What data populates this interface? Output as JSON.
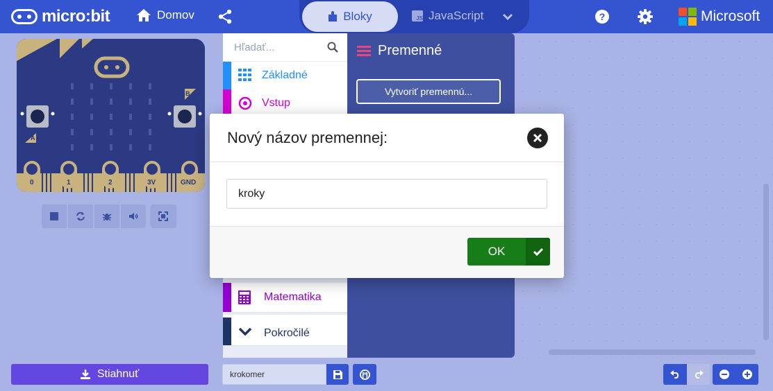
{
  "header": {
    "logo_text": "micro:bit",
    "home_label": "Domov",
    "tabs": {
      "blocks_label": "Bloky",
      "js_label": "JavaScript",
      "js_badge": "JS"
    },
    "brand": "Microsoft",
    "colors": {
      "bar": "#3454d1",
      "ms": [
        "#f25022",
        "#7fba00",
        "#00a4ef",
        "#ffb900"
      ]
    }
  },
  "simulator": {
    "buttons": [
      "stop-icon",
      "restart-icon",
      "debug-icon",
      "sound-icon",
      "fullscreen-icon"
    ],
    "board_labels": {
      "button_a": "A",
      "button_b": "B",
      "pins": [
        "0",
        "1",
        "2",
        "3V",
        "GND"
      ]
    }
  },
  "toolbox": {
    "search_placeholder": "Hľadať...",
    "categories": [
      {
        "label": "Základné",
        "color": "#1e90ff"
      },
      {
        "label": "Vstup",
        "color": "#d400d4"
      },
      {
        "label": "Matematika",
        "color": "#9400d3"
      },
      {
        "label": "Pokročilé",
        "color": "#3c3c3c"
      }
    ]
  },
  "flyout": {
    "title": "Premenné",
    "make_variable_label": "Vytvoriť premennú..."
  },
  "dialog": {
    "title": "Nový názov premennej:",
    "input_value": "kroky",
    "ok_label": "OK"
  },
  "footer": {
    "download_label": "Stiahnuť",
    "project_name": "krokomer"
  }
}
